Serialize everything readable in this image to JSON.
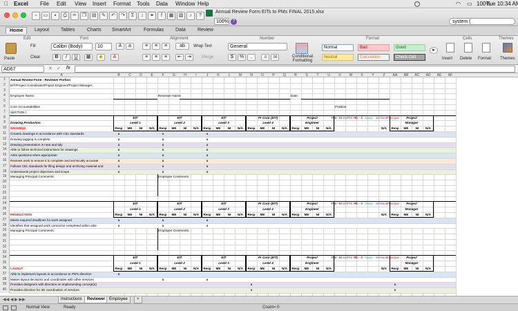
{
  "menubar": {
    "apple": "",
    "app": "Excel",
    "items": [
      "File",
      "Edit",
      "View",
      "Insert",
      "Format",
      "Tools",
      "Data",
      "Window",
      "Help"
    ],
    "battery": "100%",
    "clock": "Tue 10:34 AM"
  },
  "titlebar": {
    "file_title": "Annual Review Form EITs to PMs FINAL 2015.xlsx",
    "zoom": "100%",
    "search_value": "system ("
  },
  "ribbon_tabs": [
    "Home",
    "Layout",
    "Tables",
    "Charts",
    "SmartArt",
    "Formulas",
    "Data",
    "Review"
  ],
  "ribbon": {
    "groups": [
      "Edit",
      "Font",
      "Alignment",
      "Number",
      "Format",
      "Cells",
      "Themes"
    ],
    "paste": "Paste",
    "fill": "Fill",
    "clear": "Clear",
    "font_name": "Calibri (Body)",
    "font_size": "10",
    "wrap_text": "Wrap Text",
    "merge": "Merge",
    "number_format": "General",
    "conditional": "Conditional Formatting",
    "styles": [
      {
        "label": "Normal",
        "bg": "#ffffff",
        "fg": "#000000",
        "bd": "#8aa0b8"
      },
      {
        "label": "Bad",
        "bg": "#ffc7ce",
        "fg": "#9c0006",
        "bd": "#d9a0a8"
      },
      {
        "label": "Good",
        "bg": "#c6efce",
        "fg": "#006100",
        "bd": "#9ccf9c"
      },
      {
        "label": "Neutral",
        "bg": "#ffeb9c",
        "fg": "#9c6500",
        "bd": "#d8c078"
      },
      {
        "label": "Calculation",
        "bg": "#f2f2f2",
        "fg": "#fa7d00",
        "bd": "#7f7f7f"
      },
      {
        "label": "Check Cell",
        "bg": "#a5a5a5",
        "fg": "#ffffff",
        "bd": "#3f3f3f"
      }
    ],
    "cells_buttons": [
      "Insert",
      "Delete",
      "Format"
    ],
    "themes_button": "Themes"
  },
  "formula_bar": {
    "cell_ref": "AD67",
    "fx": "fx",
    "value": ""
  },
  "columns": [
    "A",
    "B",
    "C",
    "D",
    "E",
    "F",
    "G",
    "H",
    "I",
    "J",
    "K",
    "L",
    "M",
    "N",
    "O",
    "P",
    "Q",
    "R",
    "S",
    "T",
    "U",
    "V",
    "W",
    "X",
    "Y",
    "Z",
    "AA",
    "AB",
    "AC",
    "AD",
    "AE",
    "AF"
  ],
  "row_numbers": [
    "1",
    "2",
    "3",
    "4",
    "5",
    "6",
    "7",
    "8",
    "9",
    "10",
    "11",
    "12",
    "13",
    "14",
    "15",
    "16",
    "17",
    "18",
    "19",
    "20",
    "21",
    "22",
    "23",
    "24",
    "25",
    "26",
    "27",
    "28",
    "29",
    "30",
    "31",
    "32",
    "33",
    "34",
    "35",
    "36",
    "37",
    "38",
    "39",
    "40"
  ],
  "sheet": {
    "title": "Annual Review Form - Reviewer Portion",
    "subtitle": "EIT/Project Coordinator/Project Engineer/Project Manager",
    "employee_name": "Employee Name:",
    "reviewer_name": "Reviewer Name",
    "date": "Date:",
    "core": "Core Accountabilities",
    "position": "Position",
    "section": "SECTION I",
    "drawing_production": "Drawing Production",
    "managing_comments": "Managing Principal Comments:",
    "employee_comments": "Employee Comments:",
    "level_groups": [
      {
        "title": "EIT",
        "sub": "Level 1"
      },
      {
        "title": "EIT",
        "sub": "Level 2"
      },
      {
        "title": "EIT",
        "sub": "Level 3"
      },
      {
        "title": "Pr Coor (EIT)",
        "sub": "Level 4"
      },
      {
        "title": "Project",
        "sub": "Engineer"
      }
    ],
    "pm_group": {
      "title": "Project",
      "sub": "Manager"
    },
    "sub_headers": [
      "Resp",
      "ME",
      "NI",
      "N/A"
    ],
    "roles": [
      {
        "label": "PM - M",
        "color": "#000000"
      },
      {
        "label": "SnrPM - E",
        "color": "#7030a0"
      },
      {
        "label": "PD - E",
        "color": "#c00000"
      },
      {
        "label": "Assoc",
        "color": "#00b050"
      },
      {
        "label": "SrAssoc",
        "color": "#7030a0"
      },
      {
        "label": "Principal",
        "color": "#ff0000"
      }
    ],
    "mark": "x",
    "drawing_heading": "DRAWING",
    "drawing_items": [
      "Creates drawings in accordance with CEL standards",
      "Drawing tagging is complete",
      "Drawing presentation is neat and tidy",
      "Able to follow technical instructions for drawings",
      "Asks questions when appropriate",
      "Reviews work to ensure it is complete and technically accurate",
      "Follows CEL standards for filing design and archiving material and",
      "Understands project objectives and scope"
    ],
    "production_heading": "PRODUCTION",
    "production_items": [
      "Meets required deadlines for work assigned",
      "Identifies that assigned work cannot be completed within allot"
    ],
    "layout_heading": "LAYOUT",
    "layout_items": [
      "Able to implement layouts in accordance to PM's direction",
      "Makes layout decisions and coordinates with other services",
      "Provides designers with direction on implementing concept(s)",
      "Provides direction for 3D coordination of services"
    ],
    "label_colors": {
      "heading": "#ff0000",
      "hdr_bg": "#d9d9d9"
    }
  },
  "sheet_tabs": [
    "Instructions",
    "Reviewer",
    "Employee"
  ],
  "active_tab": "Reviewer",
  "status": {
    "view": "Normal View",
    "ready": "Ready",
    "count": "Count= 0"
  }
}
